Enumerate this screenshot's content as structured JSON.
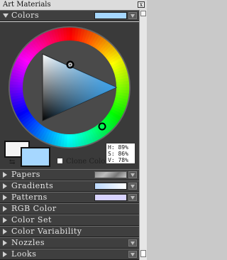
{
  "window": {
    "title": "Art Materials",
    "close_label": "x"
  },
  "panels": {
    "colors": {
      "label": "Colors",
      "swatch_color": "#a6d7ff"
    },
    "papers": {
      "label": "Papers"
    },
    "gradients": {
      "label": "Gradients"
    },
    "patterns": {
      "label": "Patterns"
    },
    "rgb": {
      "label": "RGB Color"
    },
    "colorset": {
      "label": "Color Set"
    },
    "variability": {
      "label": "Color Variability"
    },
    "nozzles": {
      "label": "Nozzles"
    },
    "looks": {
      "label": "Looks"
    }
  },
  "colors": {
    "main_color": "#a6d7ff",
    "secondary_color": "#f4f4f4",
    "clone_color_label": "Clone Color",
    "hsv": {
      "h": "H: 89%",
      "s": "S: 86%",
      "v": "V: 78%"
    }
  },
  "icons": {
    "swap": "swap-colors-icon",
    "expand": "triangle-right-icon",
    "collapse": "triangle-down-icon",
    "menu": "menu-dropdown-icon"
  }
}
